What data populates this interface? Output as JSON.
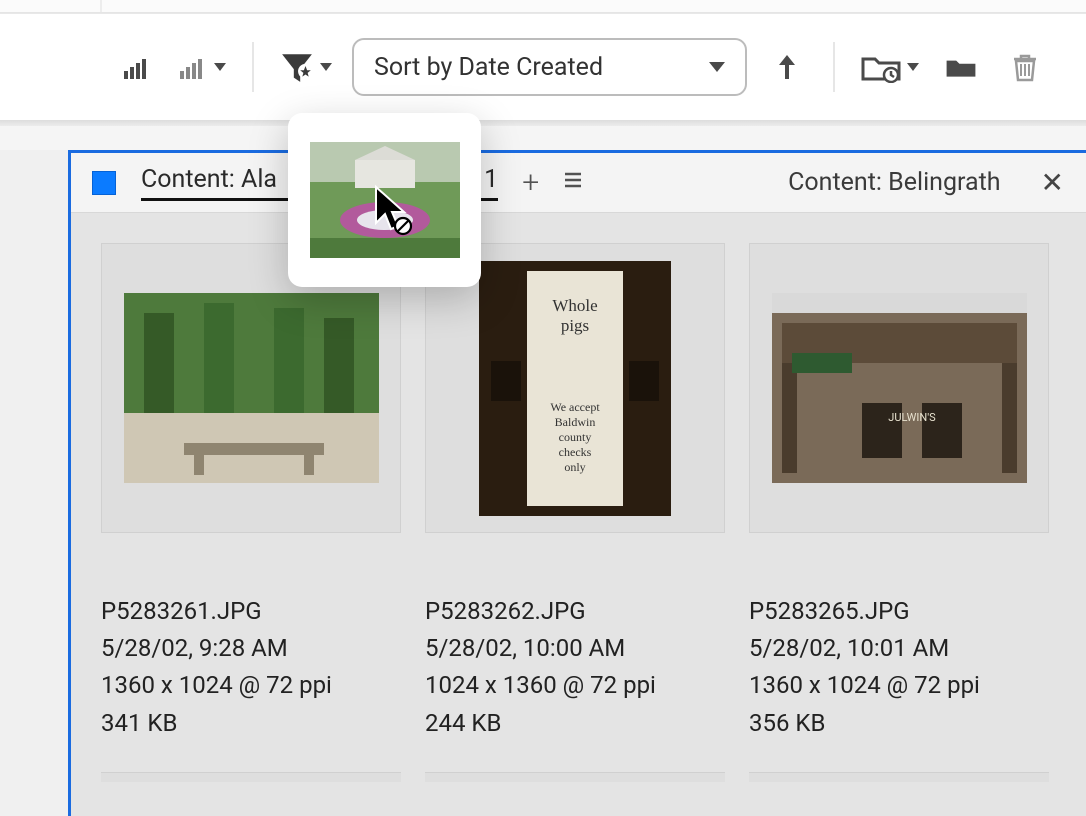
{
  "toolbar": {
    "sort_label": "Sort by Date Created"
  },
  "panel": {
    "tab_active_prefix": "Content: Ala",
    "tab_active_suffix": "sium 1",
    "tab_right": "Content: Belingrath"
  },
  "items": [
    {
      "filename": "P5283261.JPG",
      "datetime": "5/28/02, 9:28 AM",
      "dimensions": "1360 x 1024 @ 72 ppi",
      "size": "341 KB"
    },
    {
      "filename": "P5283262.JPG",
      "datetime": "5/28/02, 10:00 AM",
      "dimensions": "1024 x 1360 @ 72 ppi",
      "size": "244 KB"
    },
    {
      "filename": "P5283265.JPG",
      "datetime": "5/28/02, 10:01 AM",
      "dimensions": "1360 x 1024 @ 72 ppi",
      "size": "356 KB"
    }
  ]
}
